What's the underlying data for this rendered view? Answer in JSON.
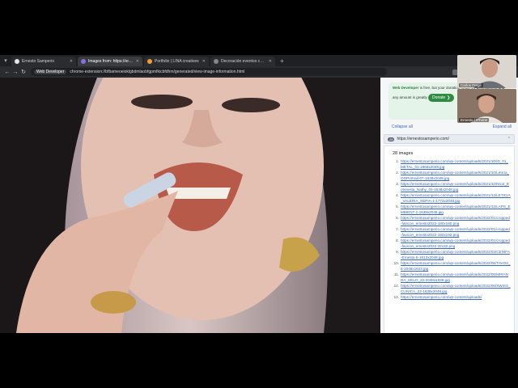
{
  "tabs": [
    {
      "title": "Ernesto Samperio",
      "color": "#e6e6e6",
      "active": false
    },
    {
      "title": "Images from: https://ernestoo...",
      "color": "#8b6ee0",
      "active": true
    },
    {
      "title": "Portfolio | LINA creatives",
      "color": "#f0a030",
      "active": false
    },
    {
      "title": "Decoración eventos corporativ...",
      "color": "#888888",
      "active": false
    }
  ],
  "toolbar": {
    "chip": "Web Developer",
    "url": "chrome-extension://bfbameoeioklgbdmlaobfgpmfkicbfdhm/generated/view-image-information.html"
  },
  "panel": {
    "promo_title": "Web Developer",
    "promo_text": "is free, but your donation helps my development and any amount is greatly",
    "donate_label": "Donate",
    "collapse_all": "Collapse all",
    "expand_all": "Expand all",
    "site_badge": "28",
    "site_url": "https://ernestosamperio.com/",
    "image_count": "28 images",
    "images": [
      "https://ernestosamperio.com/wp-content/uploads/2021/10/ID_01_METAL_01-1668x2048.jpg",
      "https://ernestosamperio.com/wp-content/uploads/2021/10/Leticia_OOPortrait-07-1628x2048.jpg",
      "https://ernestosamperio.com/wp-content/uploads/2021/10/Nicol_Entrevista_Nathy_03-1638x2048.jpg",
      "https://ernestosamperio.com/wp-content/uploads/2021/12/LETICIA_VALERIA_SEPIA-1-1772x2048.jpg",
      "https://ernestosamperio.com/wp-content/uploads/2021/12/LAPS_EMBIENT-1-1638x2048.jpg",
      "https://ernestosamperio.com/wp-content/uploads/2022/01/cropped-favicon_ernesto2022-180x180.png",
      "https://ernestosamperio.com/wp-content/uploads/2022/01/cropped-favicon_ernesto2022-192x192.png",
      "https://ernestosamperio.com/wp-content/uploads/2022/01/cropped-favicon_ernesto2022-32x32.png",
      "https://ernestosamperio.com/wp-content/uploads/2022/03/CENIFA-Ernesto-5-1613x2048.jpg",
      "https://ernestosamperio.com/wp-content/uploads/2022/06/TAVOS_5-2048x1623.jpg",
      "https://ernestosamperio.com/wp-content/uploads/2022/06/MIRANDA_HELO_22-2048x1638.jpg",
      "https://ernestosamperio.com/wp-content/uploads/2022/06/SWISS_CLINICA_22-1638x2048.jpg",
      "https://ernestosamperio.com/wp-content/uploads/"
    ]
  },
  "cams": {
    "cam1_label": "Carlos Fregil",
    "cam2_label": "Ernesto | iPhone"
  },
  "colors": {
    "panel_bg": "#f5f6f7",
    "link": "#3a67b5",
    "donate": "#2f8a43",
    "promo_bg": "#e5f4e8"
  }
}
